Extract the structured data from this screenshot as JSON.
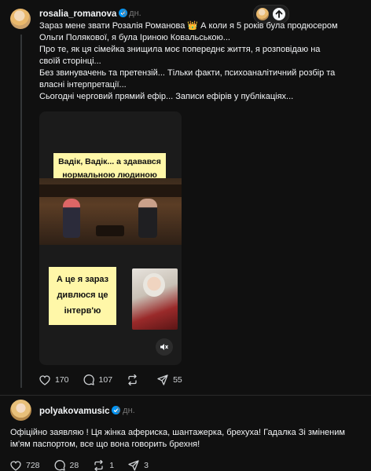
{
  "post1": {
    "username": "rosalia_romanova",
    "time": "6 дн.",
    "lines": [
      "Зараз мене звати Розалія Романова 👑  А коли я 5 років була продюсером",
      "Ольги Полякової, я була Іриною Ковальською...",
      "Про те, як ця сімейка знищила моє попереднє життя, я розповідаю на",
      "своїй сторінці...",
      "Без звинувачень та претензій... Тільки факти, психоаналітичний розбір та",
      "власні інтерпретації...",
      "Сьогодні черговий прямий ефір... Записи ефірів у публікаціях..."
    ],
    "media": {
      "caption_top": [
        "Вадік, Вадік... а здавався",
        "нормальною людиною"
      ],
      "caption_bottom": [
        "А це я зараз",
        "дивлюся це",
        "інтерв'ю"
      ],
      "mute_icon": "speaker-muted-icon"
    },
    "stats": {
      "likes": "170",
      "comments": "107",
      "reposts": "",
      "shares": "55"
    }
  },
  "post2": {
    "username": "polyakovamusic",
    "time": "3 дн.",
    "lines": [
      "Офіційно заявляю ! Ця жінка афериска, шантажерка, брехуха! Гадалка Зі зміненим",
      "ім'ям паспортом, все що вона говорить брехня!"
    ],
    "stats": {
      "likes": "728",
      "comments": "28",
      "reposts": "1",
      "shares": "3"
    }
  },
  "colors": {
    "background": "#101010",
    "verified": "#0095f6",
    "caption_bg": "#fff7a8"
  }
}
